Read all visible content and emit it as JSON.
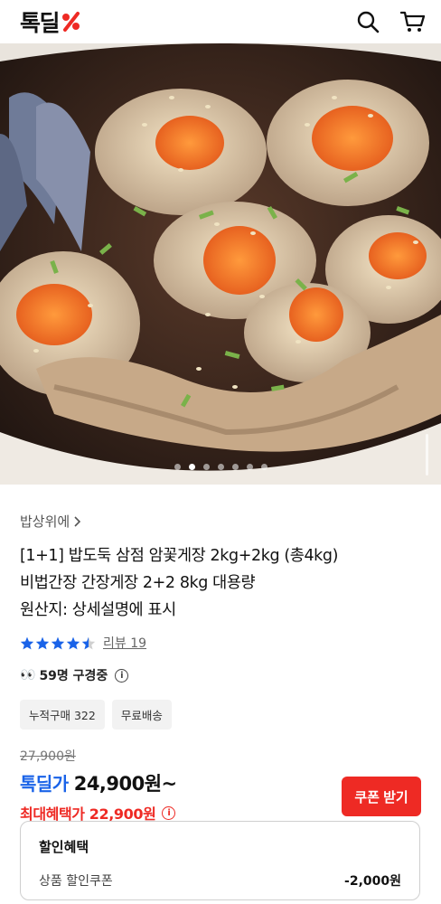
{
  "header": {
    "logo_text": "톡딜",
    "logo_color": "#ee2a24",
    "icons": [
      "percent-logo-icon",
      "search-icon",
      "cart-icon"
    ]
  },
  "hero": {
    "image_description_icon": "crab-photo",
    "slide_count": 7,
    "active_slide": 1
  },
  "product": {
    "seller": "밥상위에",
    "title_line1": "[1+1] 밥도둑 삼점 암꽃게장 2kg+2kg (총4kg)",
    "title_line2": "비법간장 간장게장 2+2 8kg 대용량",
    "title_line3": "원산지: 상세설명에 표시",
    "rating_value": 4.5,
    "review_label": "리뷰 19",
    "viewers": "59명 구경중",
    "tags": [
      "누적구매 322",
      "무료배송"
    ]
  },
  "pricing": {
    "original_price": "27,900원",
    "deal_label": "톡딜가",
    "deal_price": "24,900원~",
    "max_benefit": "최대혜택가 22,900원",
    "coupon_button": "쿠폰 받기",
    "accent_blue": "#1a63e8",
    "accent_red": "#ee2a24"
  },
  "discount": {
    "title": "할인혜택",
    "item_label": "상품 할인쿠폰",
    "item_amount": "-2,000원"
  }
}
